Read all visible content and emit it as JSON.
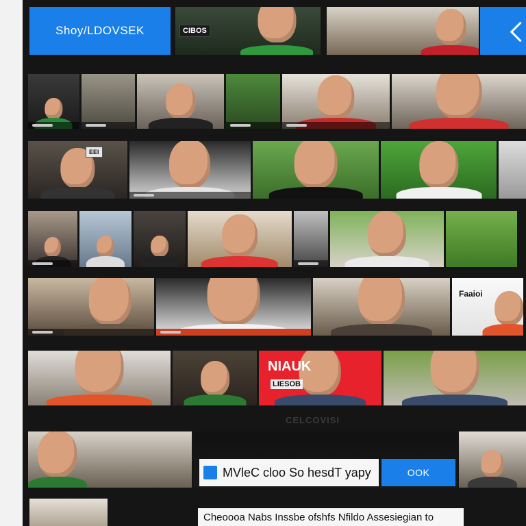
{
  "header": {
    "logo_text": "Shoy/LDOVSEK",
    "clip_tag": "CIBOS"
  },
  "rows": [
    {
      "tag": ""
    },
    {
      "tag": ""
    },
    {
      "tag": "EEI"
    },
    {
      "tag": ""
    },
    {
      "tag": "Faaioi"
    },
    {
      "tag": ""
    }
  ],
  "feature": {
    "red_panel_title": "NIAUK",
    "red_panel_sub": "LIESOB"
  },
  "below_feature_caption": "CELCOVISI",
  "search_bar": {
    "text": "MVleC cloo So hesdT yapy",
    "button": "OOK"
  },
  "bottom_text": "Cheoooa Nabs Inssbe ofshfs Nfildo Assesiegian to",
  "colors": {
    "accent_blue": "#1a7fe8",
    "background": "#151515",
    "red_panel": "#e8222c"
  },
  "icons": {
    "nav_next": "chevron-left-icon"
  }
}
